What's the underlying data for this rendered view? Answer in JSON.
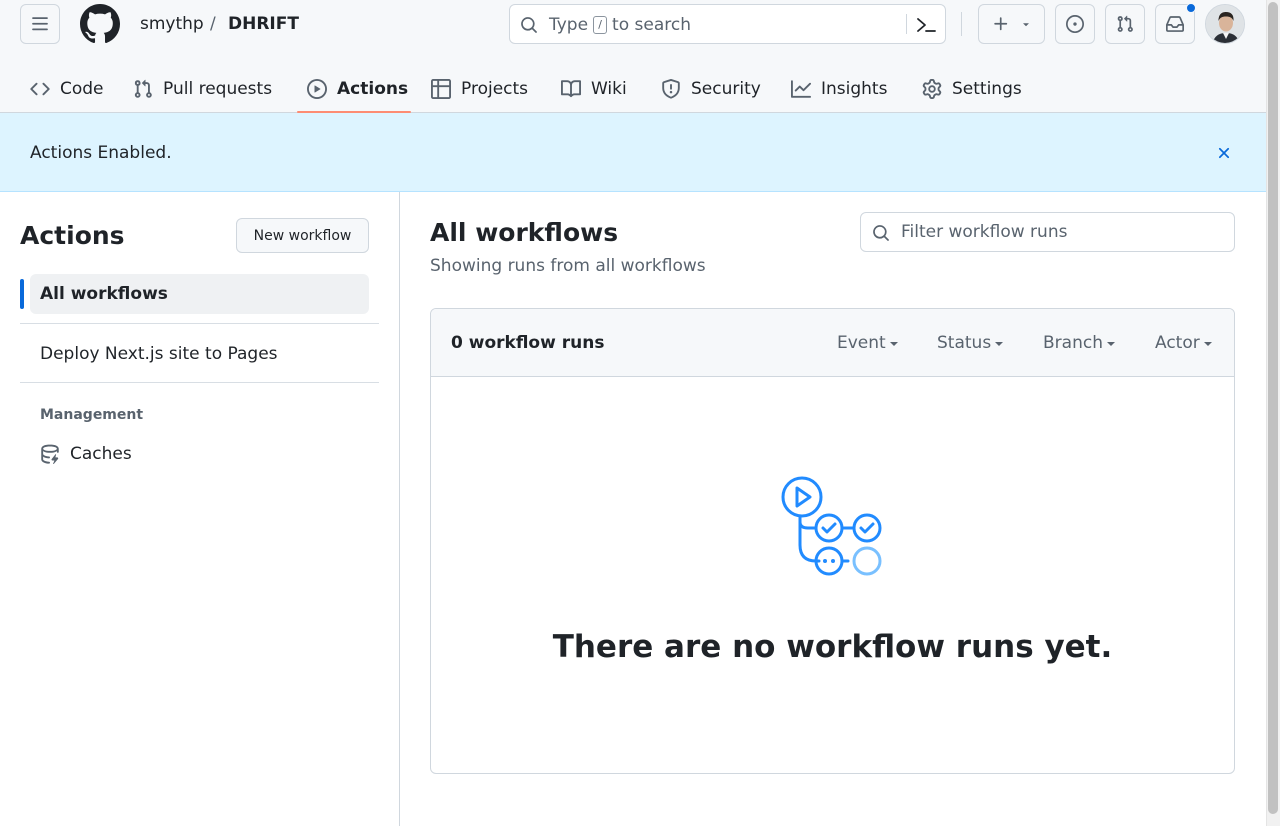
{
  "header": {
    "owner": "smythp",
    "separator": "/",
    "repo": "DHRIFT",
    "search": {
      "placeholder_before": "Type",
      "slash_key": "/",
      "placeholder_after": "to search"
    }
  },
  "tabs": [
    {
      "label": "Code",
      "icon": "code-icon"
    },
    {
      "label": "Pull requests",
      "icon": "git-pull-request-icon"
    },
    {
      "label": "Actions",
      "icon": "play-icon",
      "active": true
    },
    {
      "label": "Projects",
      "icon": "table-icon"
    },
    {
      "label": "Wiki",
      "icon": "book-icon"
    },
    {
      "label": "Security",
      "icon": "shield-icon"
    },
    {
      "label": "Insights",
      "icon": "graph-icon"
    },
    {
      "label": "Settings",
      "icon": "gear-icon"
    }
  ],
  "flash": {
    "message": "Actions Enabled."
  },
  "sidebar": {
    "title": "Actions",
    "new_workflow_label": "New workflow",
    "items": [
      {
        "label": "All workflows",
        "active": true
      },
      {
        "label": "Deploy Next.js site to Pages"
      }
    ],
    "management_heading": "Management",
    "management_items": [
      {
        "label": "Caches",
        "icon": "cache-icon"
      }
    ]
  },
  "main": {
    "title": "All workflows",
    "subtitle": "Showing runs from all workflows",
    "filter_placeholder": "Filter workflow runs",
    "run_count": "0 workflow runs",
    "filters": [
      "Event",
      "Status",
      "Branch",
      "Actor"
    ],
    "empty_message": "There are no workflow runs yet."
  },
  "colors": {
    "accent": "#0969da",
    "tab_underline": "#fd8c73",
    "flash_bg": "#ddf4ff",
    "empty_art": "#218bff"
  }
}
